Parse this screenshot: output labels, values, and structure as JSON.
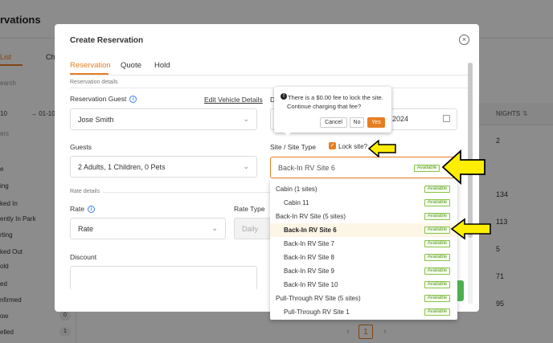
{
  "background": {
    "title": "rvations",
    "tabs": {
      "list": "List",
      "other": "Ch"
    },
    "search_placeholder": "earch",
    "date_from": "10",
    "date_sep": "→",
    "date_to": "01-10",
    "filter_label": "ers",
    "statuses": [
      {
        "label": "e",
        "count": ""
      },
      {
        "label": "ing",
        "count": ""
      },
      {
        "label": "ked In",
        "count": ""
      },
      {
        "label": "ently In Park",
        "count": ""
      },
      {
        "label": "rting",
        "count": ""
      },
      {
        "label": "ked Out",
        "count": ""
      },
      {
        "label": "old",
        "count": ""
      },
      {
        "label": "ed",
        "count": ""
      },
      {
        "label": "nfirmed",
        "count": ""
      },
      {
        "label": "ow",
        "count": "0"
      },
      {
        "label": "elled",
        "count": "1"
      }
    ],
    "table": {
      "nights_header": "NIGHTS",
      "nights": [
        "2",
        "134",
        "113",
        "5",
        "71",
        "95"
      ]
    },
    "pager": {
      "prev": "‹",
      "current": "1",
      "next": "›"
    }
  },
  "modal": {
    "title": "Create Reservation",
    "close_icon": "×",
    "tabs": [
      "Reservation",
      "Quote",
      "Hold"
    ],
    "reservation_details_label": "Reservation details",
    "guest_label": "Reservation Guest",
    "edit_vehicle_link": "Edit Vehicle Details",
    "guest_value": "Jose Smith",
    "date_label": "D",
    "date_value": "2024",
    "guests_label": "Guests",
    "guests_value": "2 Adults, 1 Children, 0 Pets",
    "site_type_label": "Site / Site Type",
    "lock_site_label": "Lock site?",
    "site_value": "Back-In RV Site 6",
    "site_badge": "Available",
    "rate_details_label": "Rate details",
    "rate_label": "Rate",
    "rate_value": "Rate",
    "rate_type_label": "Rate Type",
    "rate_type_value": "Daily",
    "discount_label": "Discount"
  },
  "popover": {
    "line1": "There is a $0.00 fee to lock the site.",
    "line2": "Continue charging that fee?",
    "cancel": "Cancel",
    "no": "No",
    "yes": "Yes"
  },
  "dropdown": [
    {
      "type": "group",
      "label": "Cabin (1 sites)",
      "badge": "Available"
    },
    {
      "type": "item",
      "label": "Cabin 11",
      "badge": "Available"
    },
    {
      "type": "group",
      "label": "Back-In RV Site (5 sites)",
      "badge": "Available"
    },
    {
      "type": "item",
      "label": "Back-In RV Site 6",
      "badge": "Available",
      "selected": true
    },
    {
      "type": "item",
      "label": "Back-In RV Site 7",
      "badge": "Available"
    },
    {
      "type": "item",
      "label": "Back-In RV Site 8",
      "badge": "Available"
    },
    {
      "type": "item",
      "label": "Back-In RV Site 9",
      "badge": "Available"
    },
    {
      "type": "item",
      "label": "Back-In RV Site 10",
      "badge": "Available"
    },
    {
      "type": "group",
      "label": "Pull-Through RV Site (5 sites)",
      "badge": "Available"
    },
    {
      "type": "item",
      "label": "Pull-Through RV Site 1",
      "badge": "Available"
    }
  ],
  "colors": {
    "accent": "#e67e22",
    "available": "#5a9e1e",
    "arrow": "#ffee00"
  }
}
